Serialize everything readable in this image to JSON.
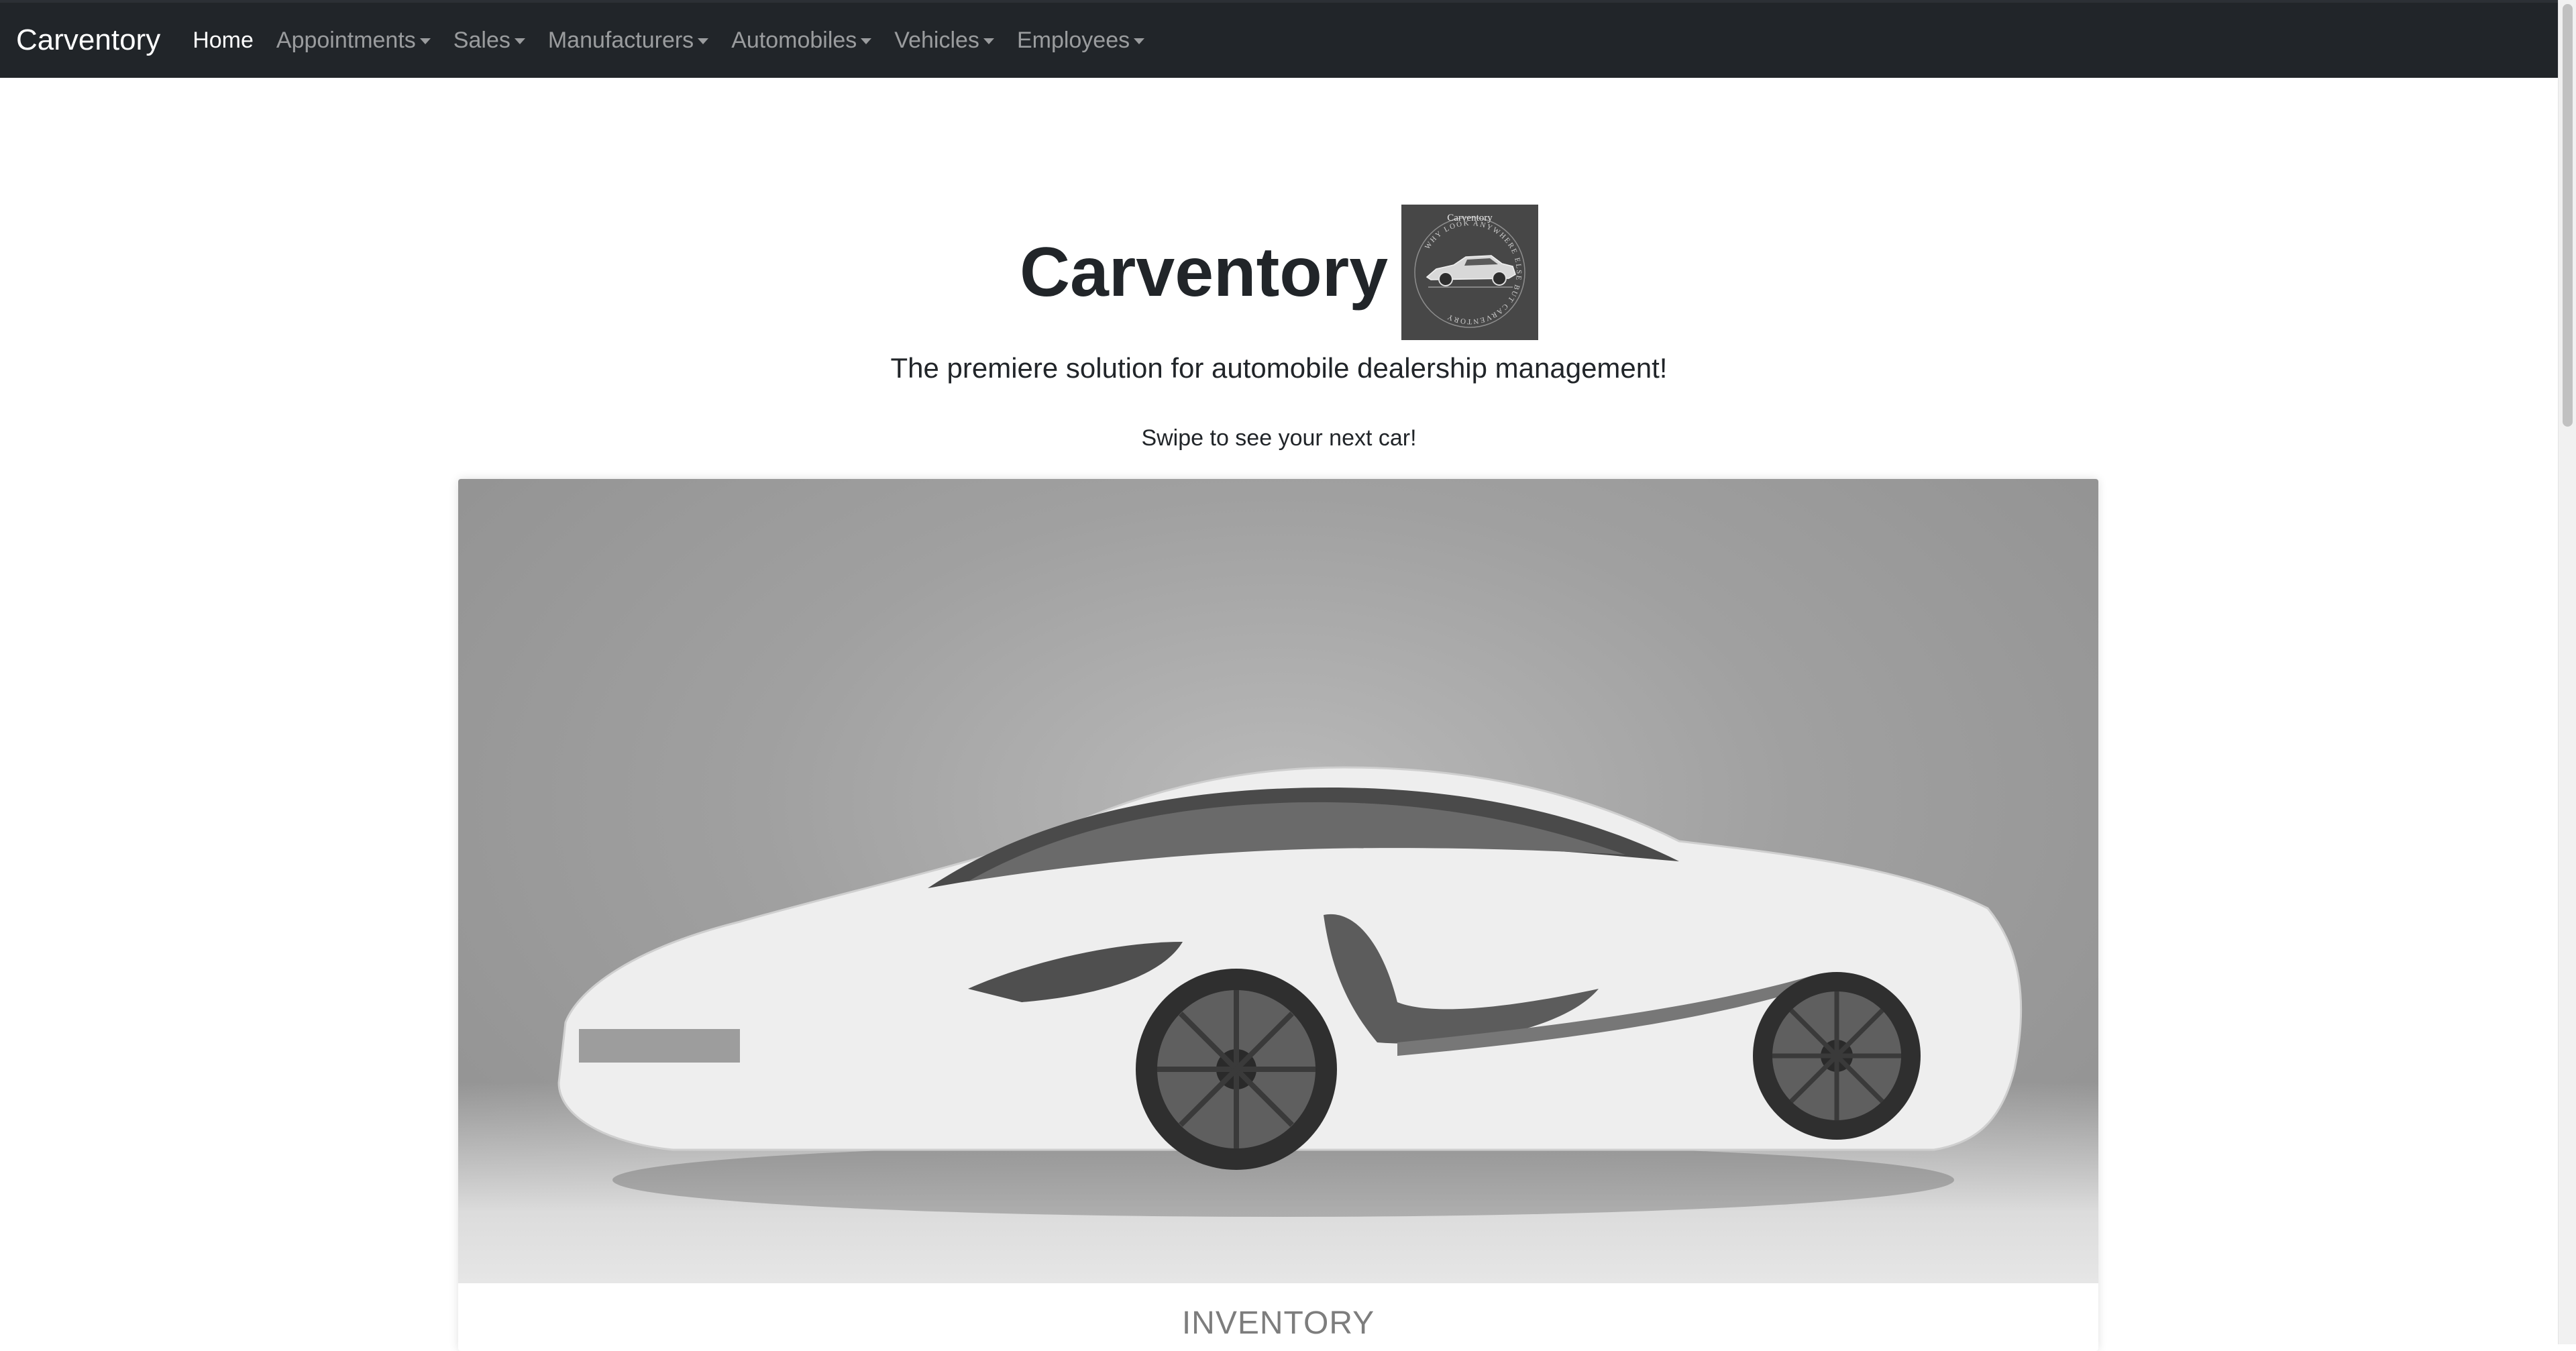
{
  "navbar": {
    "brand": "Carventory",
    "items": [
      {
        "label": "Home",
        "dropdown": false,
        "active": true
      },
      {
        "label": "Appointments",
        "dropdown": true,
        "active": false
      },
      {
        "label": "Sales",
        "dropdown": true,
        "active": false
      },
      {
        "label": "Manufacturers",
        "dropdown": true,
        "active": false
      },
      {
        "label": "Automobiles",
        "dropdown": true,
        "active": false
      },
      {
        "label": "Vehicles",
        "dropdown": true,
        "active": false
      },
      {
        "label": "Employees",
        "dropdown": true,
        "active": false
      }
    ]
  },
  "hero": {
    "title": "Carventory",
    "subtitle": "The premiere solution for automobile dealership management!",
    "swipe_text": "Swipe to see your next car!",
    "logo": {
      "top_text": "Carventory",
      "ring_text": "WHY LOOK ANYWHERE ELSE BUT CARVENTORY"
    }
  },
  "carousel": {
    "slide_caption": "INVENTORY",
    "image": "white-sports-car"
  },
  "colors": {
    "navbar_bg": "#212529",
    "nav_active": "#ffffff",
    "nav_muted": "#8c8f93",
    "logo_bg": "#474747",
    "caption": "#7d7d7d"
  }
}
